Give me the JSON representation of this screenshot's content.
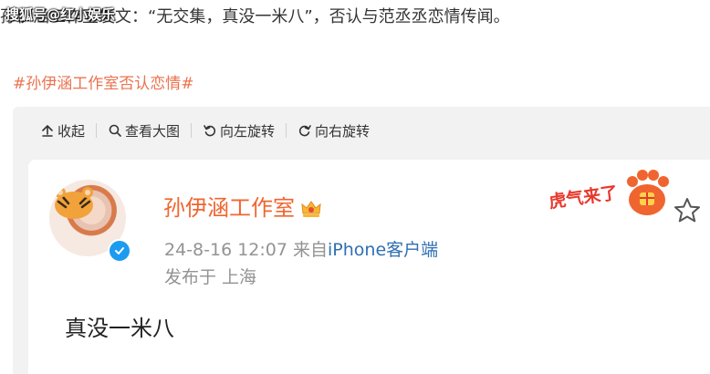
{
  "intro": {
    "text": "孙伊涵工作室发文：“无交集，真没一米八”，否认与范丞丞恋情传闻。"
  },
  "watermark": {
    "text": "搜狐号@红小娱乐"
  },
  "hashtag": {
    "text": "#孙伊涵工作室否认恋情#"
  },
  "toolbar": {
    "items": [
      {
        "label": "收起",
        "icon": "collapse-up-icon"
      },
      {
        "label": "查看大图",
        "icon": "search-icon"
      },
      {
        "label": "向左旋转",
        "icon": "rotate-left-icon"
      },
      {
        "label": "向右旋转",
        "icon": "rotate-right-icon"
      }
    ]
  },
  "post": {
    "username": "孙伊涵工作室",
    "timestamp": "24-8-16 12:07",
    "source_prefix": "来自",
    "source": "iPhone客户端",
    "location": "发布于 上海",
    "content": "真没一米八",
    "sticker_text": "虎气来了"
  },
  "colors": {
    "accent": "#eb7350",
    "username": "#f0652f",
    "source_link": "#2f6fb3",
    "meta_gray": "#939393",
    "viewer_bg": "#f2f2f2",
    "verified_blue": "#1d9bf0"
  }
}
